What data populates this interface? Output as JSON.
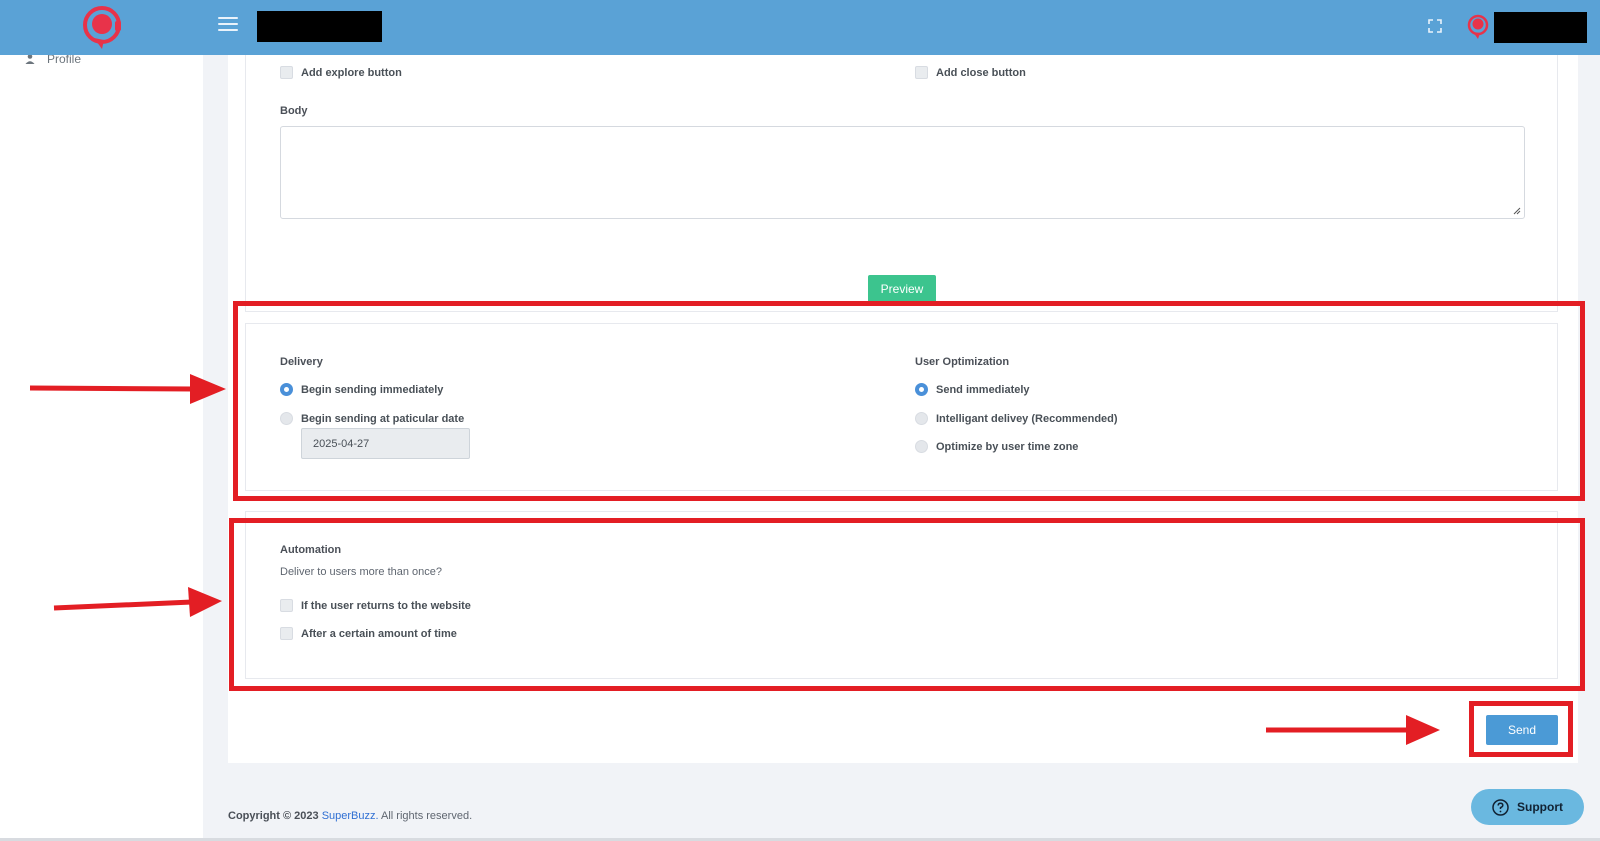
{
  "header": {
    "logo_icon": "headset-logo-icon",
    "menu_icon": "hamburger-menu-icon",
    "fullscreen_icon": "fullscreen-icon",
    "avatar_icon": "user-avatar-icon",
    "accent_color": "#5aa2d6"
  },
  "sidebar": {
    "items": [
      {
        "label": "Profile",
        "icon": "person-icon"
      }
    ]
  },
  "form": {
    "add_explore_button_label": "Add explore button",
    "add_close_button_label": "Add close button",
    "body_label": "Body",
    "body_value": "",
    "preview_label": "Preview",
    "delivery": {
      "title": "Delivery",
      "options": [
        {
          "label": "Begin sending immediately",
          "checked": true
        },
        {
          "label": "Begin sending at paticular date",
          "checked": false
        }
      ],
      "date_value": "2025-04-27"
    },
    "user_optimization": {
      "title": "User Optimization",
      "options": [
        {
          "label": "Send immediately",
          "checked": true
        },
        {
          "label": "Intelligant delivey (Recommended)",
          "checked": false
        },
        {
          "label": "Optimize by user time zone",
          "checked": false
        }
      ]
    },
    "automation": {
      "title": "Automation",
      "subtitle": "Deliver to users more than once?",
      "options": [
        {
          "label": "If the user returns to the website",
          "checked": false
        },
        {
          "label": "After a certain amount of time",
          "checked": false
        }
      ]
    },
    "send_label": "Send"
  },
  "footer": {
    "copyright_prefix": "Copyright © 2023",
    "brand": "SuperBuzz.",
    "suffix": "All rights reserved.",
    "support_label": "Support",
    "support_icon": "question-circle-icon"
  },
  "annotation_color": "#e31e24"
}
